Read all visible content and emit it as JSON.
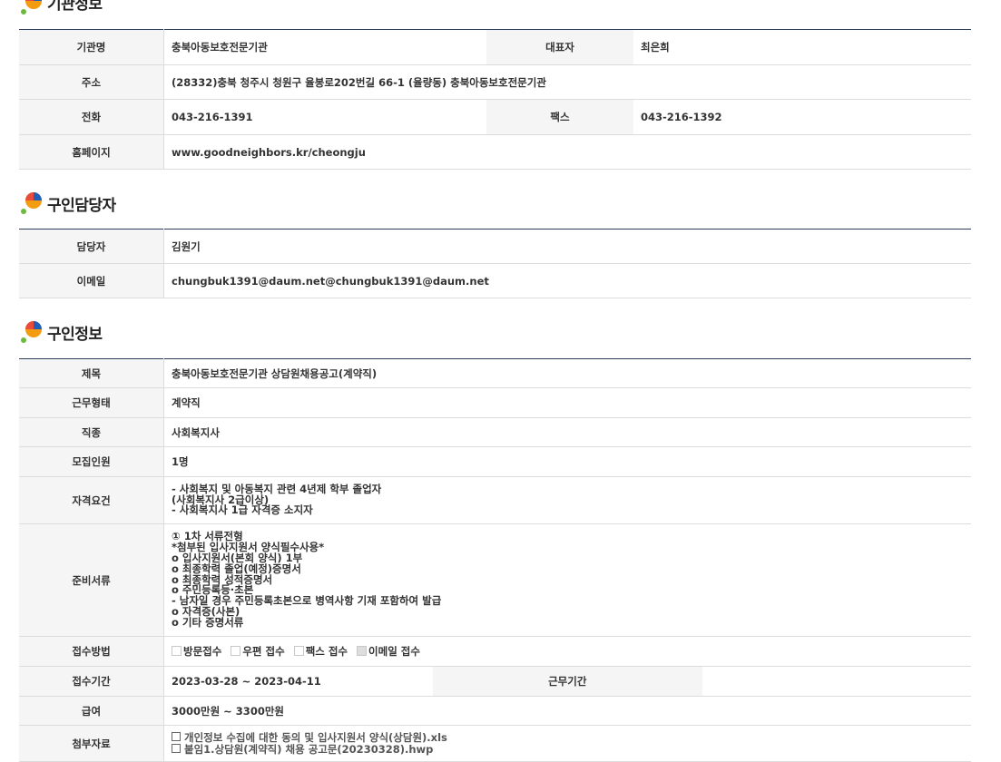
{
  "sections": {
    "org": {
      "title": "기관정보"
    },
    "contact": {
      "title": "구인담당자"
    },
    "job": {
      "title": "구인정보"
    }
  },
  "org": {
    "name_label": "기관명",
    "name": "충북아동보호전문기관",
    "rep_label": "대표자",
    "rep": "최은희",
    "addr_label": "주소",
    "addr": "(28332)충북 청주시 청원구 율봉로202번길 66-1 (율량동) 충북아동보호전문기관",
    "tel_label": "전화",
    "tel": "043-216-1391",
    "fax_label": "팩스",
    "fax": "043-216-1392",
    "home_label": "홈페이지",
    "home": "www.goodneighbors.kr/cheongju"
  },
  "contact": {
    "person_label": "담당자",
    "person": "김원기",
    "email_label": "이메일",
    "email": "chungbuk1391@daum.net@chungbuk1391@daum.net"
  },
  "job": {
    "title_label": "제목",
    "title": "충북아동보호전문기관 상담원채용공고(계약직)",
    "type_label": "근무형태",
    "type": "계약직",
    "kind_label": "직종",
    "kind": "사회복지사",
    "count_label": "모집인원",
    "count": "1명",
    "qual_label": "자격요건",
    "qual": "- 사회복지 및 아동복지 관련 4년제 학부 졸업자\n  (사회복지사 2급이상)\n- 사회복지사 1급 자격증 소지자",
    "docs_label": "준비서류",
    "docs": "① 1차 서류전형\n*첨부된 입사지원서 양식필수사용*\no 입사지원서(본회 양식) 1부\no 최종학력 졸업(예정)증명서\no 최종학력 성적증명서\no 주민등록등·초본\n- 남자일 경우 주민등록초본으로 병역사항 기재 포함하여 발급\no 자격증(사본)\no 기타 증명서류",
    "method_label": "접수방법",
    "methods": [
      {
        "label": "방문접수",
        "checked": false
      },
      {
        "label": "우편 접수",
        "checked": false
      },
      {
        "label": "팩스 접수",
        "checked": false
      },
      {
        "label": "이메일 접수",
        "checked": true
      }
    ],
    "period_label": "접수기간",
    "period": "2023-03-28 ~ 2023-04-11",
    "workperiod_label": "근무기간",
    "workperiod": "",
    "salary_label": "급여",
    "salary": "3000만원 ~ 3300만원",
    "files_label": "첨부자료",
    "files": [
      "개인정보 수집에 대한 동의 및 입사지원서 양식(상담원).xls",
      "붙임1.상담원(계약직) 채용 공고문(20230328).hwp"
    ]
  }
}
